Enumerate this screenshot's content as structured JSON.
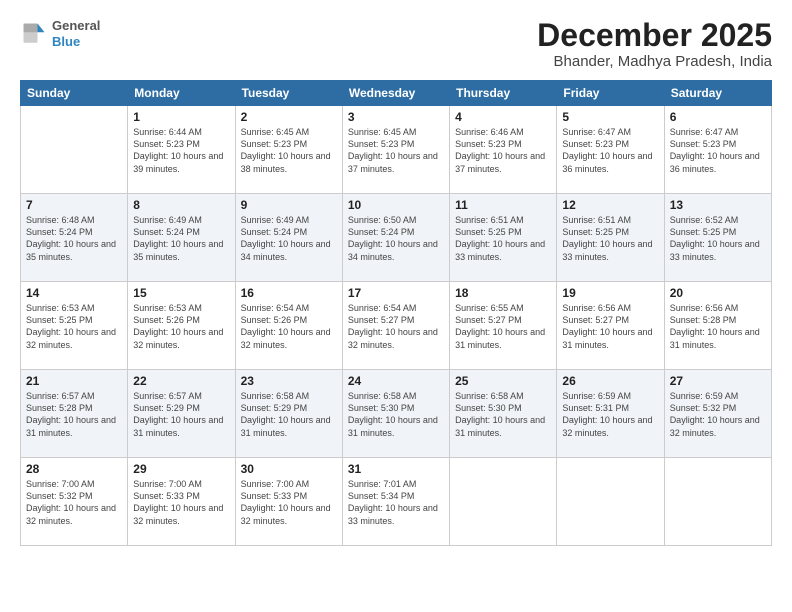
{
  "logo": {
    "line1": "General",
    "line2": "Blue"
  },
  "title": "December 2025",
  "subtitle": "Bhander, Madhya Pradesh, India",
  "weekdays": [
    "Sunday",
    "Monday",
    "Tuesday",
    "Wednesday",
    "Thursday",
    "Friday",
    "Saturday"
  ],
  "rows": [
    [
      {
        "day": "",
        "info": ""
      },
      {
        "day": "1",
        "info": "Sunrise: 6:44 AM\nSunset: 5:23 PM\nDaylight: 10 hours\nand 39 minutes."
      },
      {
        "day": "2",
        "info": "Sunrise: 6:45 AM\nSunset: 5:23 PM\nDaylight: 10 hours\nand 38 minutes."
      },
      {
        "day": "3",
        "info": "Sunrise: 6:45 AM\nSunset: 5:23 PM\nDaylight: 10 hours\nand 37 minutes."
      },
      {
        "day": "4",
        "info": "Sunrise: 6:46 AM\nSunset: 5:23 PM\nDaylight: 10 hours\nand 37 minutes."
      },
      {
        "day": "5",
        "info": "Sunrise: 6:47 AM\nSunset: 5:23 PM\nDaylight: 10 hours\nand 36 minutes."
      },
      {
        "day": "6",
        "info": "Sunrise: 6:47 AM\nSunset: 5:23 PM\nDaylight: 10 hours\nand 36 minutes."
      }
    ],
    [
      {
        "day": "7",
        "info": "Sunrise: 6:48 AM\nSunset: 5:24 PM\nDaylight: 10 hours\nand 35 minutes."
      },
      {
        "day": "8",
        "info": "Sunrise: 6:49 AM\nSunset: 5:24 PM\nDaylight: 10 hours\nand 35 minutes."
      },
      {
        "day": "9",
        "info": "Sunrise: 6:49 AM\nSunset: 5:24 PM\nDaylight: 10 hours\nand 34 minutes."
      },
      {
        "day": "10",
        "info": "Sunrise: 6:50 AM\nSunset: 5:24 PM\nDaylight: 10 hours\nand 34 minutes."
      },
      {
        "day": "11",
        "info": "Sunrise: 6:51 AM\nSunset: 5:25 PM\nDaylight: 10 hours\nand 33 minutes."
      },
      {
        "day": "12",
        "info": "Sunrise: 6:51 AM\nSunset: 5:25 PM\nDaylight: 10 hours\nand 33 minutes."
      },
      {
        "day": "13",
        "info": "Sunrise: 6:52 AM\nSunset: 5:25 PM\nDaylight: 10 hours\nand 33 minutes."
      }
    ],
    [
      {
        "day": "14",
        "info": "Sunrise: 6:53 AM\nSunset: 5:25 PM\nDaylight: 10 hours\nand 32 minutes."
      },
      {
        "day": "15",
        "info": "Sunrise: 6:53 AM\nSunset: 5:26 PM\nDaylight: 10 hours\nand 32 minutes."
      },
      {
        "day": "16",
        "info": "Sunrise: 6:54 AM\nSunset: 5:26 PM\nDaylight: 10 hours\nand 32 minutes."
      },
      {
        "day": "17",
        "info": "Sunrise: 6:54 AM\nSunset: 5:27 PM\nDaylight: 10 hours\nand 32 minutes."
      },
      {
        "day": "18",
        "info": "Sunrise: 6:55 AM\nSunset: 5:27 PM\nDaylight: 10 hours\nand 31 minutes."
      },
      {
        "day": "19",
        "info": "Sunrise: 6:56 AM\nSunset: 5:27 PM\nDaylight: 10 hours\nand 31 minutes."
      },
      {
        "day": "20",
        "info": "Sunrise: 6:56 AM\nSunset: 5:28 PM\nDaylight: 10 hours\nand 31 minutes."
      }
    ],
    [
      {
        "day": "21",
        "info": "Sunrise: 6:57 AM\nSunset: 5:28 PM\nDaylight: 10 hours\nand 31 minutes."
      },
      {
        "day": "22",
        "info": "Sunrise: 6:57 AM\nSunset: 5:29 PM\nDaylight: 10 hours\nand 31 minutes."
      },
      {
        "day": "23",
        "info": "Sunrise: 6:58 AM\nSunset: 5:29 PM\nDaylight: 10 hours\nand 31 minutes."
      },
      {
        "day": "24",
        "info": "Sunrise: 6:58 AM\nSunset: 5:30 PM\nDaylight: 10 hours\nand 31 minutes."
      },
      {
        "day": "25",
        "info": "Sunrise: 6:58 AM\nSunset: 5:30 PM\nDaylight: 10 hours\nand 31 minutes."
      },
      {
        "day": "26",
        "info": "Sunrise: 6:59 AM\nSunset: 5:31 PM\nDaylight: 10 hours\nand 32 minutes."
      },
      {
        "day": "27",
        "info": "Sunrise: 6:59 AM\nSunset: 5:32 PM\nDaylight: 10 hours\nand 32 minutes."
      }
    ],
    [
      {
        "day": "28",
        "info": "Sunrise: 7:00 AM\nSunset: 5:32 PM\nDaylight: 10 hours\nand 32 minutes."
      },
      {
        "day": "29",
        "info": "Sunrise: 7:00 AM\nSunset: 5:33 PM\nDaylight: 10 hours\nand 32 minutes."
      },
      {
        "day": "30",
        "info": "Sunrise: 7:00 AM\nSunset: 5:33 PM\nDaylight: 10 hours\nand 32 minutes."
      },
      {
        "day": "31",
        "info": "Sunrise: 7:01 AM\nSunset: 5:34 PM\nDaylight: 10 hours\nand 33 minutes."
      },
      {
        "day": "",
        "info": ""
      },
      {
        "day": "",
        "info": ""
      },
      {
        "day": "",
        "info": ""
      }
    ]
  ]
}
